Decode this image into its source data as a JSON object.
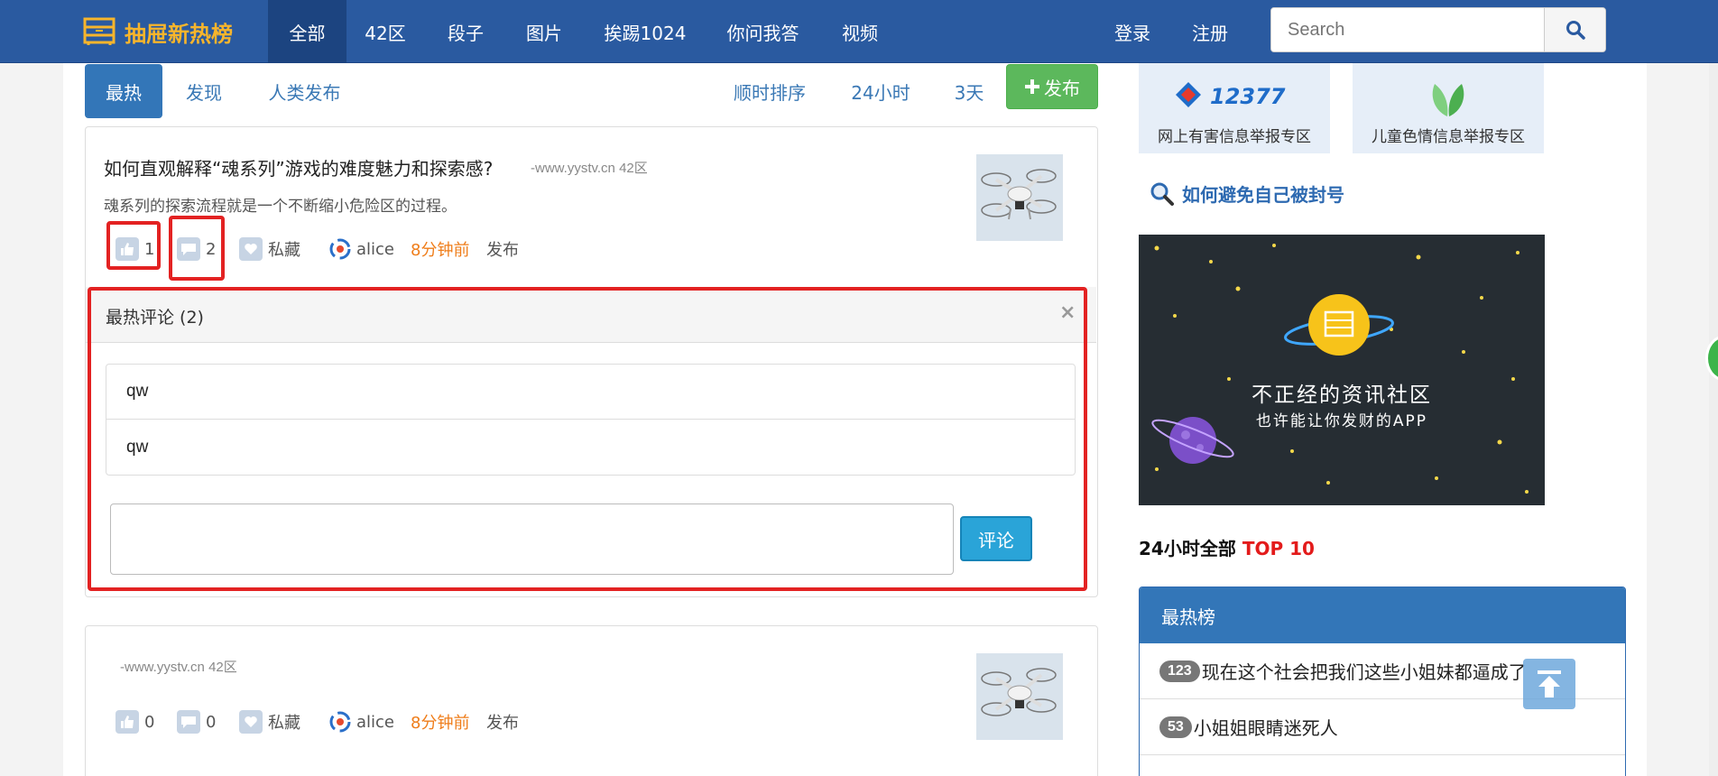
{
  "brand": {
    "name": "抽屉新热榜"
  },
  "nav": {
    "items": [
      {
        "label": "全部",
        "active": true
      },
      {
        "label": "42区",
        "active": false
      },
      {
        "label": "段子",
        "active": false
      },
      {
        "label": "图片",
        "active": false
      },
      {
        "label": "挨踢1024",
        "active": false
      },
      {
        "label": "你问我答",
        "active": false
      },
      {
        "label": "视频",
        "active": false
      }
    ],
    "login": "登录",
    "register": "注册",
    "search_placeholder": "Search"
  },
  "subnav": {
    "tabs": [
      "最热",
      "发现",
      "人类发布"
    ],
    "sort": [
      "顺时排序",
      "24小时",
      "3天"
    ],
    "publish": "发布"
  },
  "posts": [
    {
      "title": "如何直观解释“魂系列”游戏的难度魅力和探索感?",
      "source": "-www.yystv.cn  42区",
      "summary": "魂系列的探索流程就是一个不断缩小危险区的过程。",
      "likes": "1",
      "comments": "2",
      "private": "私藏",
      "author": "alice",
      "time": "8分钟前",
      "action": "发布"
    },
    {
      "title": "",
      "source": "-www.yystv.cn  42区",
      "summary": "",
      "likes": "0",
      "comments": "0",
      "private": "私藏",
      "author": "alice",
      "time": "8分钟前",
      "action": "发布"
    }
  ],
  "comments_panel": {
    "title": "最热评论 (2)",
    "close": "×",
    "items": [
      "qw",
      "qw"
    ],
    "submit": "评论"
  },
  "sidebar": {
    "report_cards": [
      "网上有害信息举报专区",
      "儿童色情信息举报专区"
    ],
    "report_logo_text": "12377",
    "avoid_link": "如何避免自己被封号",
    "banner_line1": "不正经的资讯社区",
    "banner_line2": "也许能让你发财的APP",
    "top10_prefix": "24小时全部",
    "top10_suffix": "TOP 10",
    "hot_title": "最热榜",
    "hot_items": [
      {
        "count": "123",
        "text": "现在这个社会把我们这些小姐妹都逼成了"
      },
      {
        "count": "53",
        "text": "小姐姐眼睛迷死人"
      }
    ]
  },
  "colors": {
    "navbar": "#2a5aa0",
    "brand": "#f7b52c",
    "accent": "#3376b8",
    "publish": "#5cb85c",
    "highlight": "#e32222",
    "time": "#ef7d1a"
  }
}
